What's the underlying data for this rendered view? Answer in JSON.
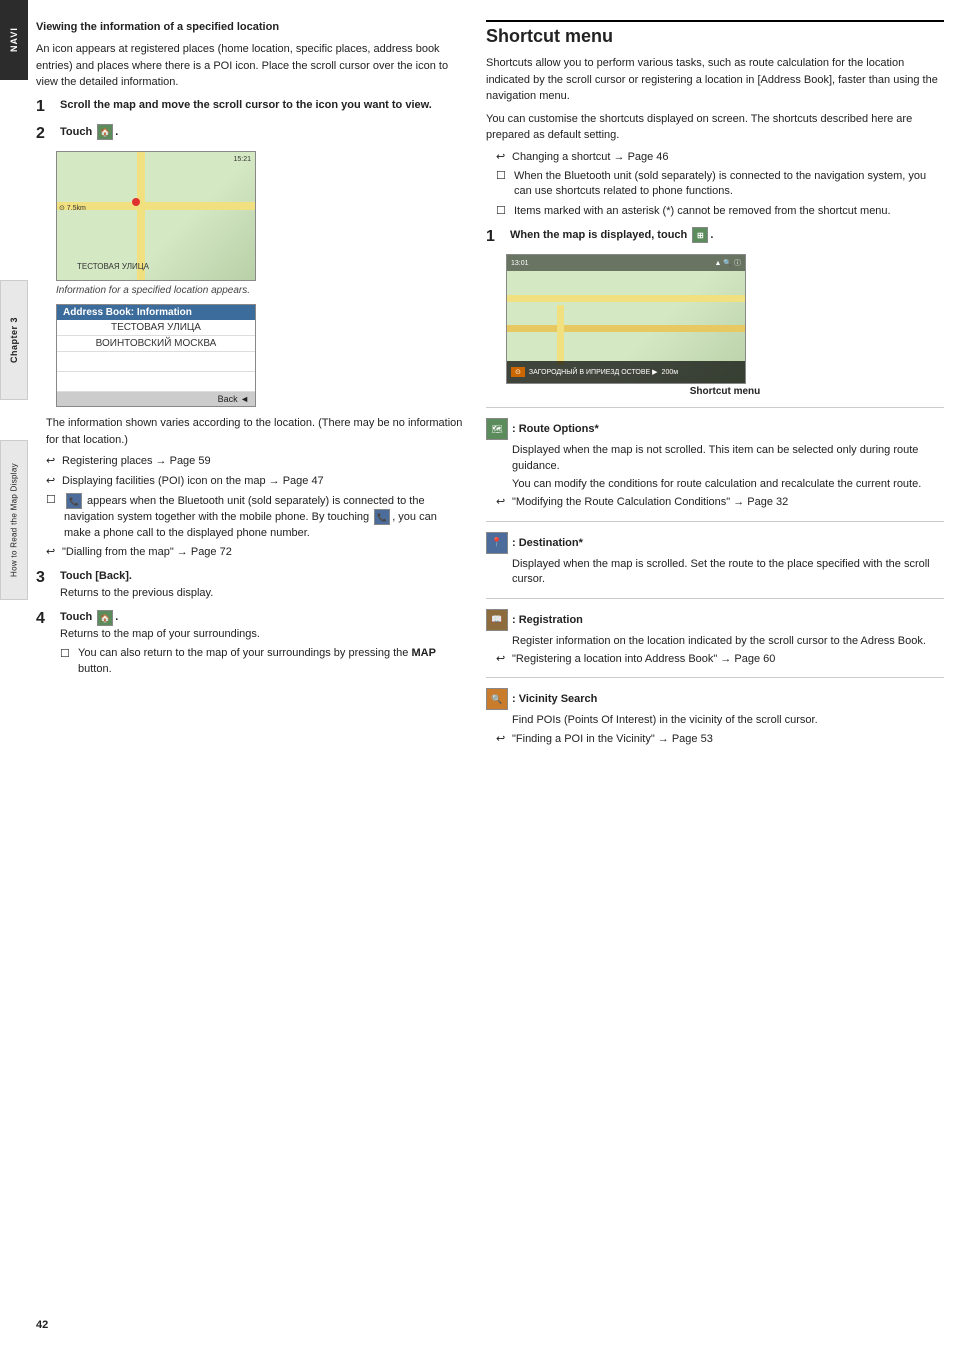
{
  "sidebar": {
    "navi_label": "NAVI",
    "chapter_label": "Chapter 3",
    "howto_label": "How to Read the Map Display"
  },
  "left_section": {
    "heading": "Viewing the information of a specified location",
    "intro": "An icon appears at registered places (home location, specific places, address book entries) and places where there is a POI icon. Place the scroll cursor over the icon to view the detailed information.",
    "steps": [
      {
        "number": "1",
        "text": "Scroll the map and move the scroll cursor to the icon you want to view."
      },
      {
        "number": "2",
        "text": "Touch"
      },
      {
        "number": "",
        "text": "Information for a specified location appears."
      }
    ],
    "address_box": {
      "header": "Address Book: Information",
      "rows": [
        "ТЕСТОВАЯ УЛИЦА",
        "ВОИНТОВСКИЙ МОСКВА"
      ],
      "footer": "Back ◄"
    },
    "info_text": "The information shown varies according to the location. (There may be no information for that location.)",
    "bullets": [
      {
        "type": "arrow",
        "text": "Registering places → Page 59"
      },
      {
        "type": "arrow",
        "text": "Displaying facilities (POI) icon on the map → Page 47"
      }
    ],
    "bluetooth_note": "appears when the Bluetooth unit (sold separately) is connected to the navigation system together with the mobile phone. By touching      , you can make a phone call to the displayed phone number.",
    "dialling_ref": "\"Dialling from the map\" → Page 72",
    "step3": {
      "number": "3",
      "label": "Touch [Back].",
      "desc": "Returns to the previous display."
    },
    "step4": {
      "number": "4",
      "label": "Touch",
      "desc_lines": [
        "Returns to the map of your surroundings.",
        "You can also return to the map of your surroundings by pressing the MAP button."
      ]
    }
  },
  "right_section": {
    "title": "Shortcut menu",
    "intro1": "Shortcuts allow you to perform various tasks, such as route calculation for the location indicated by the scroll cursor or registering a location in [Address Book], faster than using the navigation menu.",
    "intro2": "You can customise the shortcuts displayed on screen. The shortcuts described here are prepared as default setting.",
    "bullets": [
      {
        "type": "arrow",
        "text": "Changing a shortcut → Page 46"
      },
      {
        "type": "checkbox",
        "text": "When the Bluetooth unit (sold separately) is connected to the navigation system, you can use shortcuts related to phone functions."
      },
      {
        "type": "checkbox",
        "text": "Items marked with an asterisk (*) cannot be removed from the shortcut menu."
      }
    ],
    "step1": {
      "number": "1",
      "label": "When the map is displayed, touch"
    },
    "map_caption": "Shortcut menu",
    "map_bottom_text": "ЗАГОРОДНЫЙ В ИПРИЕЗД ОСТОВЕ ▶",
    "icons": [
      {
        "icon_label": ": Route Options*",
        "desc": "Displayed when the map is not scrolled. This item can be selected only during route guidance.",
        "desc2": "You can modify the conditions for route calculation and recalculate the current route.",
        "ref": "\"Modifying the Route Calculation Conditions\" → Page 32"
      },
      {
        "icon_label": ": Destination*",
        "desc": "Displayed when the map is scrolled. Set the route to the place specified with the scroll cursor."
      },
      {
        "icon_label": ": Registration",
        "desc": "Register information on the location indicated by the scroll cursor to the Adress Book.",
        "ref": "\"Registering a location into Address Book\" → Page 60"
      },
      {
        "icon_label": ": Vicinity Search",
        "desc": "Find POIs (Points Of Interest) in the vicinity of the scroll cursor.",
        "ref": "\"Finding a POI in the Vicinity\" → Page 53"
      }
    ]
  },
  "page_number": "42"
}
